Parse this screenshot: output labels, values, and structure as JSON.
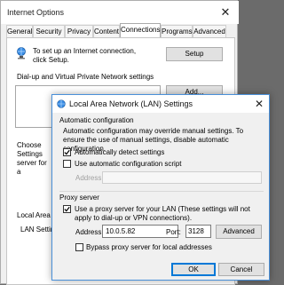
{
  "internet_options": {
    "title": "Internet Options",
    "close_glyph": "✕",
    "tabs": [
      "General",
      "Security",
      "Privacy",
      "Content",
      "Connections",
      "Programs",
      "Advanced"
    ],
    "selected_tab": "Connections",
    "setup_text": "To set up an Internet connection, click Setup.",
    "setup_button": "Setup",
    "dialup_label": "Dial-up and Virtual Private Network settings",
    "add_button": "Add...",
    "choose_settings": "Choose Settings server for a",
    "lan_heading": "Local Area N",
    "lan_text": "LAN Setting Choose Setti"
  },
  "lan_dialog": {
    "title": "Local Area Network (LAN) Settings",
    "close_glyph": "✕",
    "auto_config_heading": "Automatic configuration",
    "auto_config_desc": "Automatic configuration may override manual settings.  To ensure the use of manual settings, disable automatic configuration.",
    "auto_detect_label": "Automatically detect settings",
    "auto_detect_checked": true,
    "auto_script_label": "Use automatic configuration script",
    "auto_script_checked": false,
    "script_address_label": "Address",
    "proxy_heading": "Proxy server",
    "proxy_label": "Use a proxy server for your LAN (These settings will not apply to dial-up or VPN connections).",
    "proxy_checked": true,
    "address_label": "Address:",
    "address_value": "10.0.5.82",
    "port_label": "Port:",
    "port_value": "3128",
    "advanced_button": "Advanced",
    "bypass_label": "Bypass proxy server for local addresses",
    "bypass_checked": false,
    "ok_button": "OK",
    "cancel_button": "Cancel"
  },
  "colors": {
    "accent": "#0078d7",
    "window_bg": "#f0f0f0",
    "panel_bg": "#ffffff"
  },
  "icons": [
    "close-icon",
    "network-globe-icon",
    "lan-settings-icon",
    "checkmark-icon"
  ]
}
